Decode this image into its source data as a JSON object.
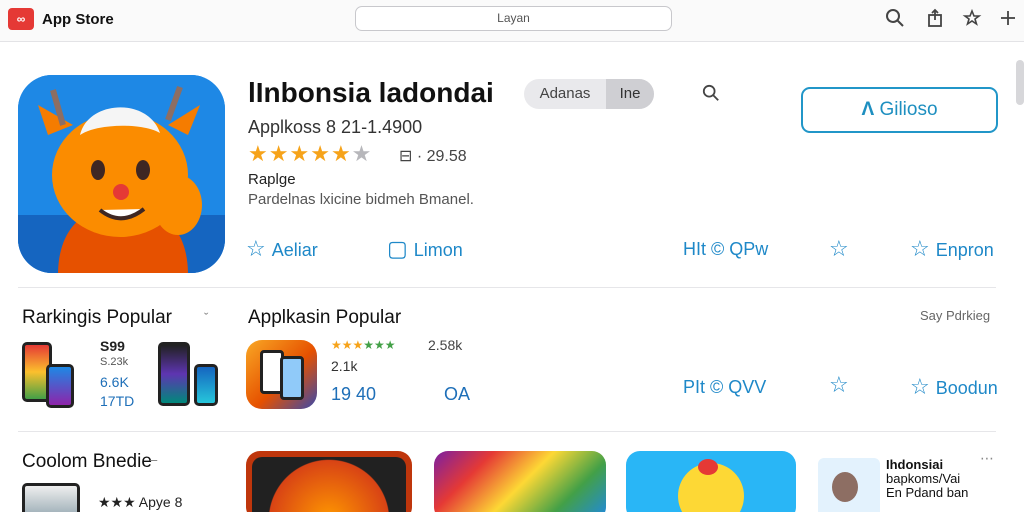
{
  "topbar": {
    "logo_text": "∞",
    "title": "App Store",
    "search_text": "Layan"
  },
  "hero": {
    "title": "lInbonsia ladondai",
    "toggle": [
      "Adanas",
      "Ine"
    ],
    "get_label": "Gilioso",
    "subtitle": "Applkoss 8 21-1.4900",
    "stars": {
      "filled": 5,
      "total": 6
    },
    "rating_count": "⊟ · 29.58",
    "category": "Raplge",
    "description": "Pardelnas lxicine bidmeh Bmanel.",
    "actions": [
      {
        "icon": "star-icon",
        "glyph": "☆",
        "label": "Aeliar"
      },
      {
        "icon": "page-icon",
        "glyph": "▢",
        "label": "Limon"
      },
      {
        "icon": "none",
        "glyph": "",
        "label": "HIt © QPw"
      },
      {
        "icon": "star-icon",
        "glyph": "☆",
        "label": ""
      },
      {
        "icon": "star-icon",
        "glyph": "☆",
        "label": "Enpron"
      }
    ]
  },
  "rankings": {
    "title": "Rarkingis Popular",
    "chevron": "ˇ",
    "values": [
      "S99",
      "S.23k",
      "6.6K",
      "17TD"
    ]
  },
  "popular": {
    "title": "Applkasin Popular",
    "see_all": "Say Pdrkieg",
    "rating": "2.58k",
    "sub": "2.1k",
    "left_value": "19 40",
    "right_value": "OA",
    "actions": [
      {
        "icon": "none",
        "glyph": "",
        "label": "PIt © QVV"
      },
      {
        "icon": "star-icon",
        "glyph": "☆",
        "label": ""
      },
      {
        "icon": "star-icon",
        "glyph": "☆",
        "label": "Boodun"
      }
    ]
  },
  "collection": {
    "title": "Coolom Bnedie",
    "dash": "–",
    "mini_rating": "★★★ Apye 8",
    "side_lines": [
      "Ihdonsiai",
      "bapkoms/Vai",
      "En Pdand ban"
    ]
  },
  "colors": {
    "accent": "#1e88c8",
    "star": "#f6a31a",
    "button_border": "#2196c8"
  }
}
